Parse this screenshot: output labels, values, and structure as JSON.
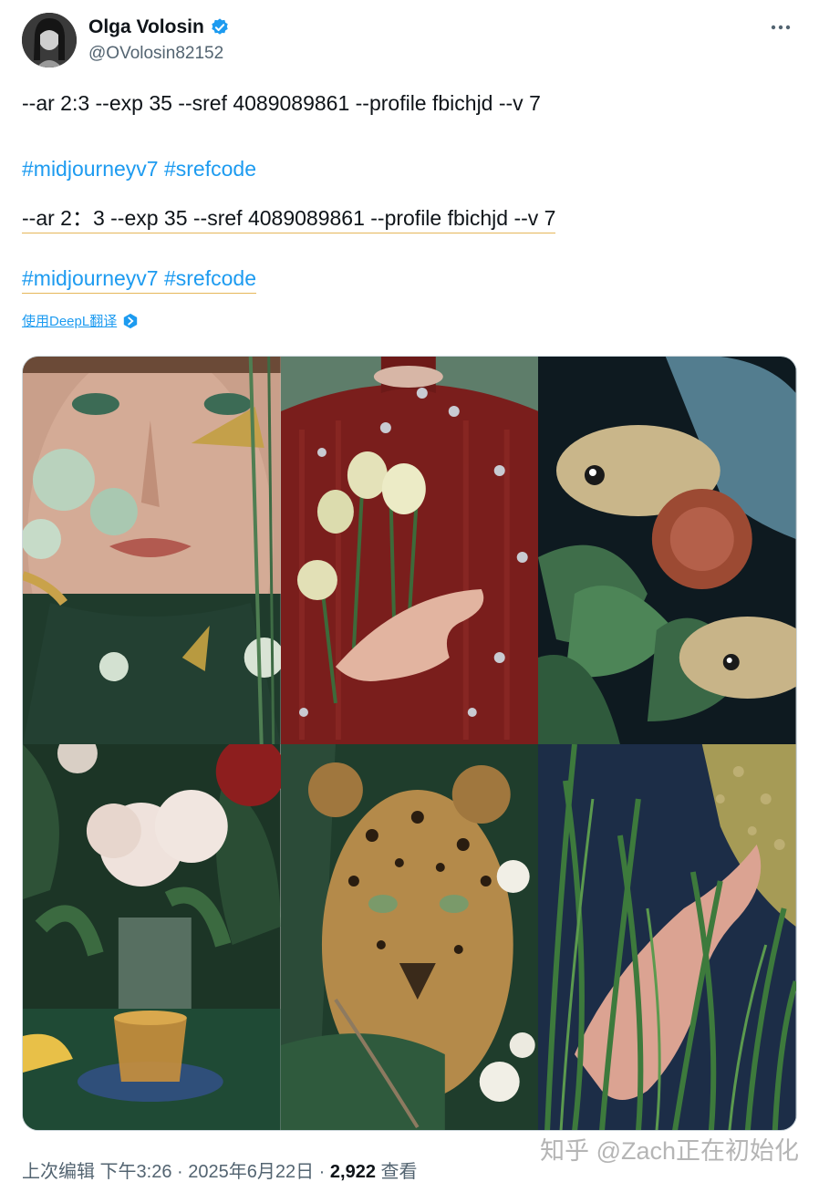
{
  "author": {
    "name": "Olga Volosin",
    "handle": "@OVolosin82152"
  },
  "tweet": {
    "line1": "--ar 2:3 --exp 35 --sref 4089089861 --profile fbichjd --v 7",
    "hashtags1": [
      "#midjourneyv7",
      "#srefcode"
    ],
    "line2": "--ar 2：3 --exp 35 --sref 4089089861 --profile fbichjd --v 7",
    "hashtags2": [
      "#midjourneyv7",
      "#srefcode"
    ]
  },
  "translate_label": "使用DeepL翻译",
  "images": [
    {
      "icon": "portrait-young-man-butterflies-image"
    },
    {
      "icon": "velvet-dress-tulips-hand-image"
    },
    {
      "icon": "goldfish-flowers-image"
    },
    {
      "icon": "peonies-tea-cup-image"
    },
    {
      "icon": "leopard-foliage-image"
    },
    {
      "icon": "hand-in-grass-image"
    }
  ],
  "footer": {
    "edited": "上次编辑 下午3:26 · 2025年6月22日 · ",
    "views_count": "2,922",
    "views_label": " 查看"
  },
  "watermark": "知乎 @Zach正在初始化",
  "colors": {
    "link": "#1d9bf0",
    "verified": "#1d9bf0",
    "muted": "#536471",
    "underline": "#e6b75a"
  }
}
